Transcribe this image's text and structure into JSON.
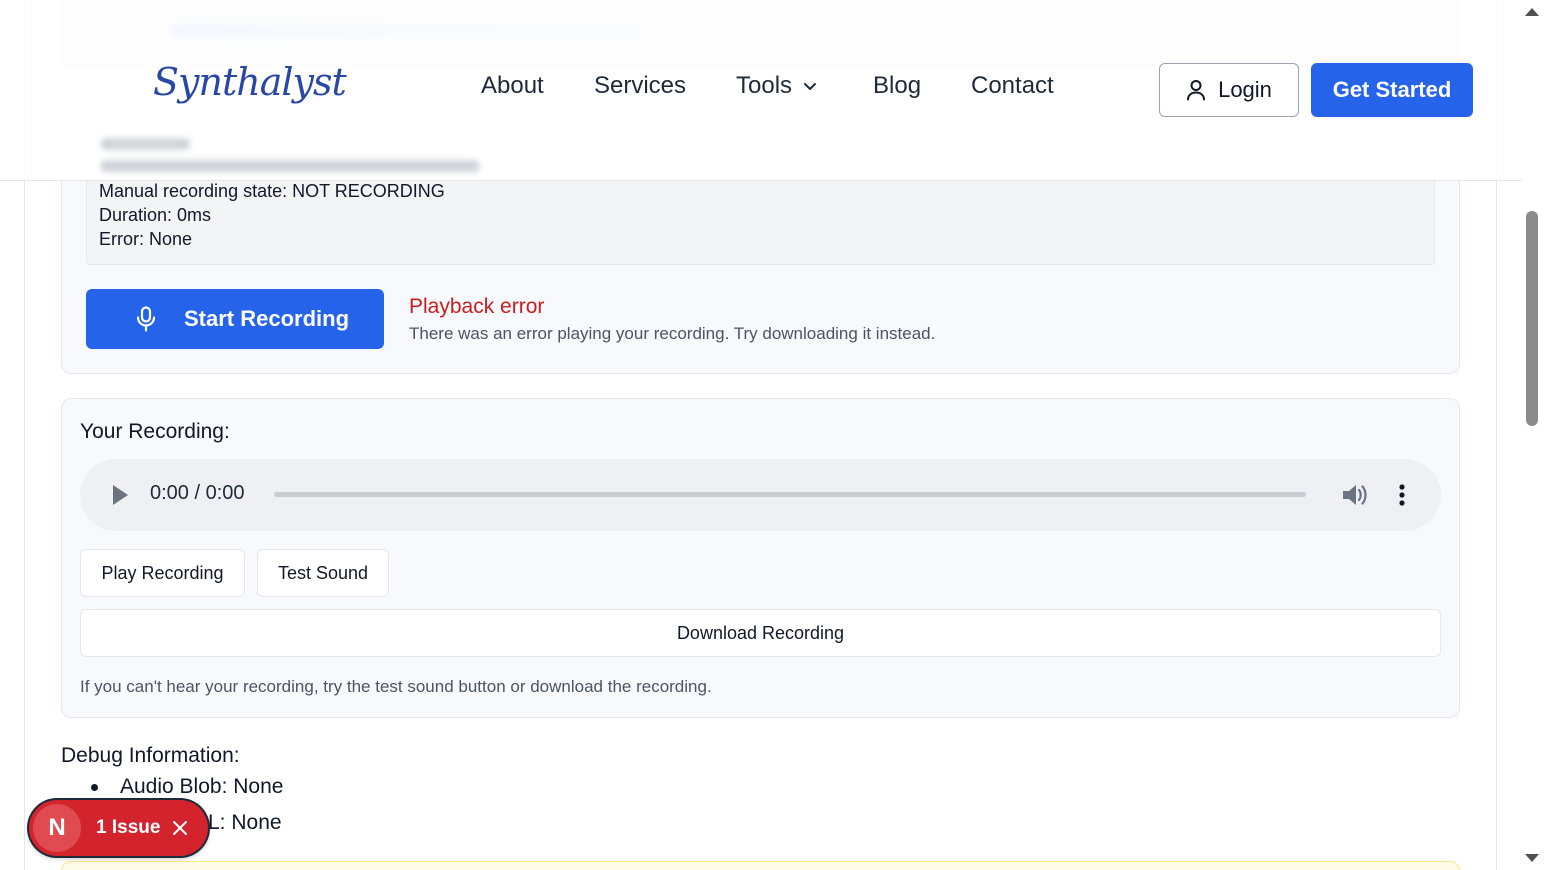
{
  "header": {
    "logo": "Synthalyst",
    "nav": {
      "about": "About",
      "services": "Services",
      "tools": "Tools",
      "blog": "Blog",
      "contact": "Contact"
    },
    "login_label": "Login",
    "get_started_label": "Get Started"
  },
  "recorder": {
    "state_lines": [
      "Manual recording state: NOT RECORDING",
      "Duration: 0ms",
      "Error: None"
    ],
    "start_button_label": "Start Recording",
    "error_title": "Playback error",
    "error_text": "There was an error playing your recording. Try downloading it instead."
  },
  "your_recording": {
    "title": "Your Recording:",
    "player_time": "0:00 / 0:00",
    "play_label": "Play Recording",
    "test_sound_label": "Test Sound",
    "download_label": "Download Recording",
    "hint": "If you can't hear your recording, try the test sound button or download the recording."
  },
  "debug": {
    "title": "Debug Information:",
    "items": [
      "Audio Blob: None",
      "L: None"
    ]
  },
  "issue_badge": {
    "letter": "N",
    "label": "1 Issue"
  },
  "colors": {
    "primary": "#2563eb",
    "error": "#c81e1e",
    "issue_badge": "#d3232d"
  }
}
